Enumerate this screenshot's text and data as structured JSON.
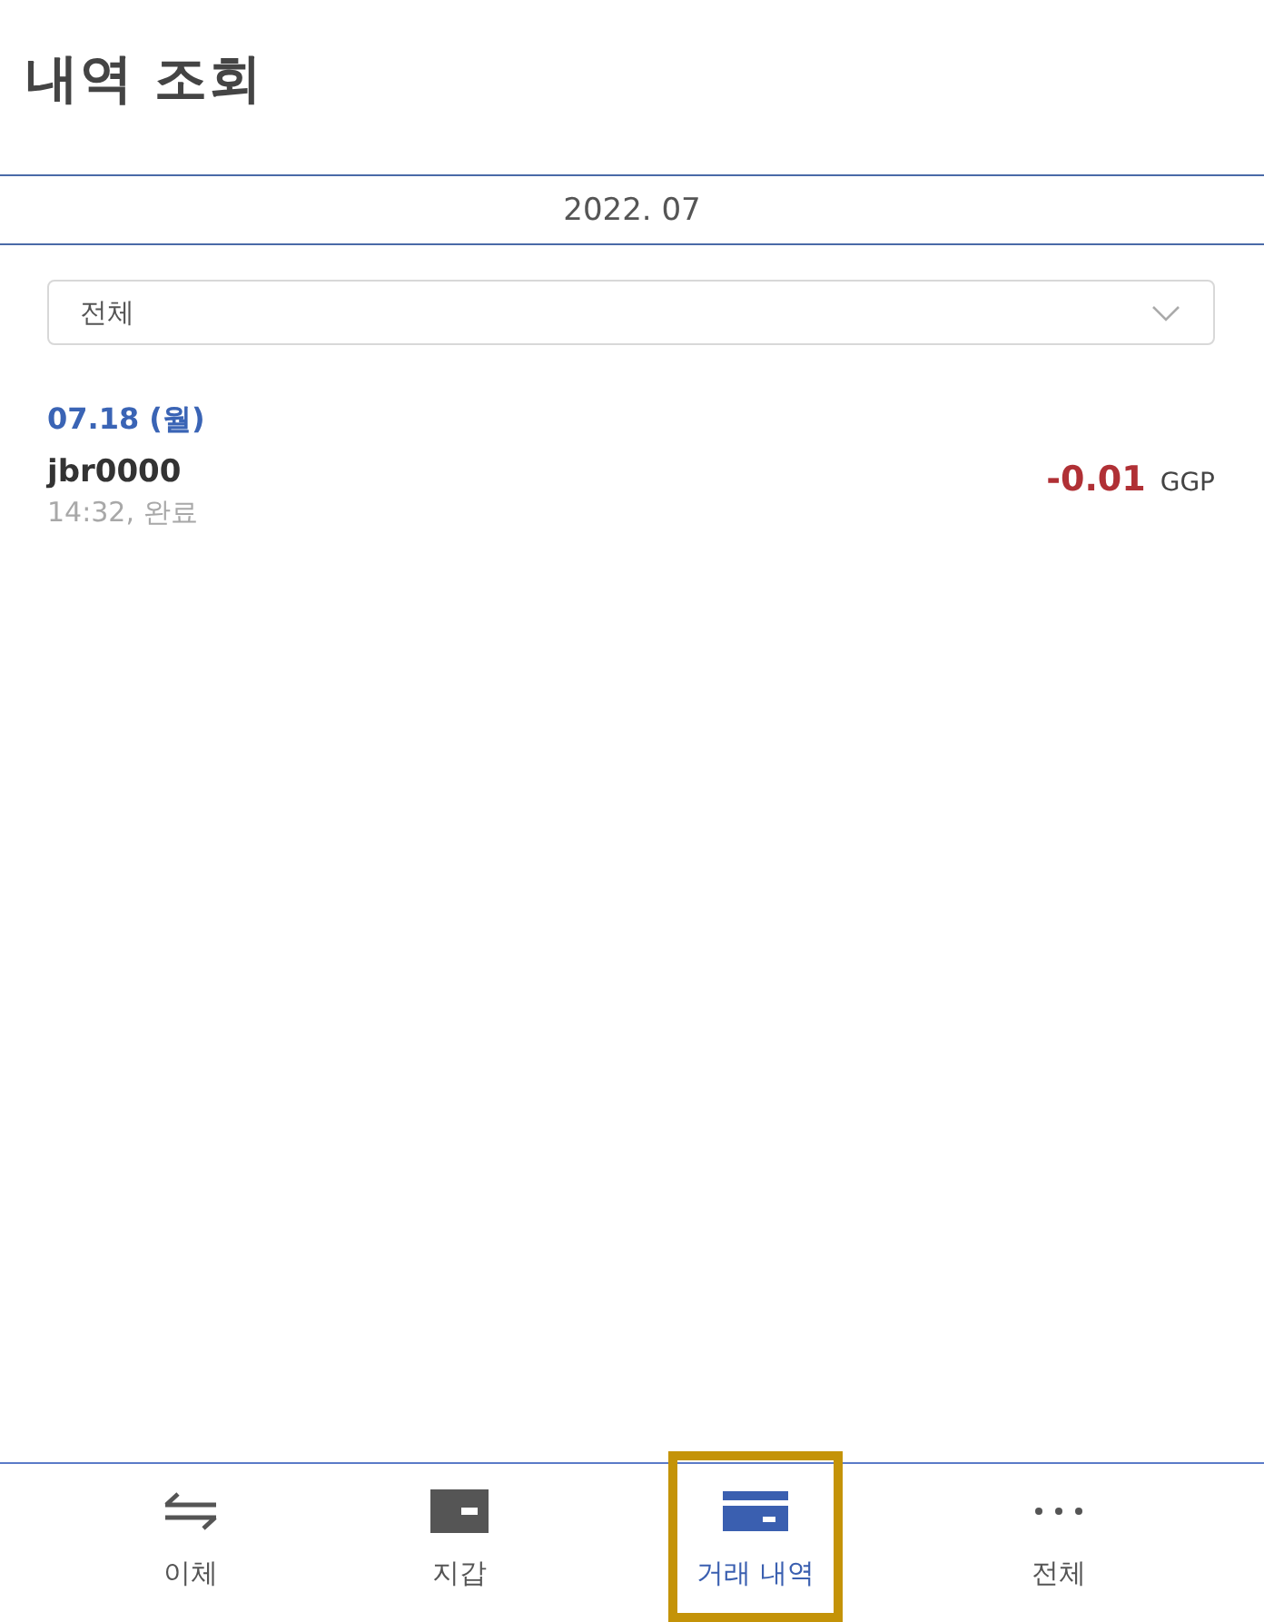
{
  "header": {
    "title": "내역 조회"
  },
  "month": {
    "label": "2022. 07"
  },
  "filter": {
    "value": "전체"
  },
  "groups": [
    {
      "date": "07.18 (월)",
      "transactions": [
        {
          "name": "jbr0000",
          "detail": "14:32, 완료",
          "amount": "-0.01",
          "currency": "GGP"
        }
      ]
    }
  ],
  "bottom_nav": [
    {
      "kind": "transfer",
      "label": "이체",
      "selected": false,
      "highlighted": false
    },
    {
      "kind": "wallet",
      "label": "지갑",
      "selected": false,
      "highlighted": false
    },
    {
      "kind": "history",
      "label": "거래 내역",
      "selected": true,
      "highlighted": true
    },
    {
      "kind": "more",
      "label": "전체",
      "selected": false,
      "highlighted": false
    }
  ]
}
